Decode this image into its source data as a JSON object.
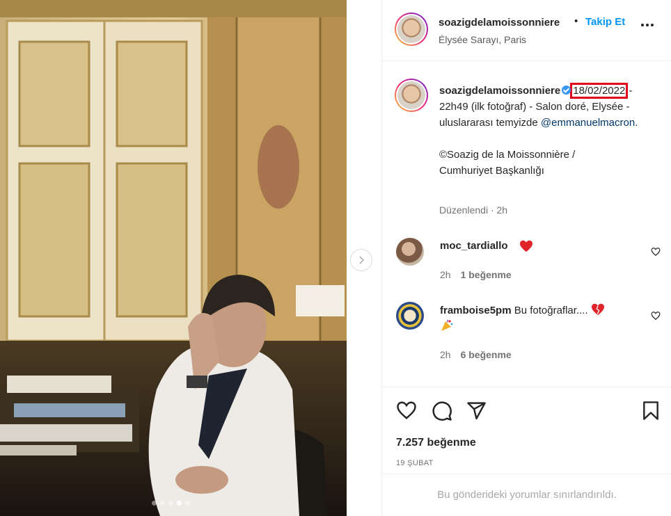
{
  "post": {
    "username": "soazigdelamoissonniere",
    "separator": "•",
    "follow_label": "Takip Et",
    "location": "Élysée Sarayı, Paris",
    "carousel": {
      "count": 5,
      "active_index": 3
    }
  },
  "caption": {
    "username": "soazigdelamoissonniere",
    "date_highlight": "18/02/2022",
    "text_part1": " - 22h49 (ilk fotoğraf) - Salon doré, Elysée - uluslararası temyizde ",
    "mention": "@emmanuelmacron",
    "text_part2": ".",
    "credit_line1": "©Soazig de la Moissonnière /",
    "credit_line2": "Cumhuriyet Başkanlığı",
    "edited": "Düzenlendi · 2h"
  },
  "comments": [
    {
      "username": "moc_tardiallo",
      "text": "",
      "emoji": "heart",
      "time": "2h",
      "likes": "1 beğenme"
    },
    {
      "username": "framboise5pm",
      "text": "Bu fotoğraflar....",
      "emoji": "heart-party",
      "time": "2h",
      "likes": "6 beğenme"
    }
  ],
  "footer": {
    "likes": "7.257 beğenme",
    "date": "19 ŞUBAT",
    "restricted": "Bu gönderideki yorumlar sınırlandırıldı."
  },
  "icons": {
    "like": "heart-icon",
    "comment": "comment-icon",
    "share": "send-icon",
    "save": "bookmark-icon"
  },
  "colors": {
    "accent": "#0095f6",
    "highlight_box": "#e0001b",
    "mention": "#00376b"
  }
}
